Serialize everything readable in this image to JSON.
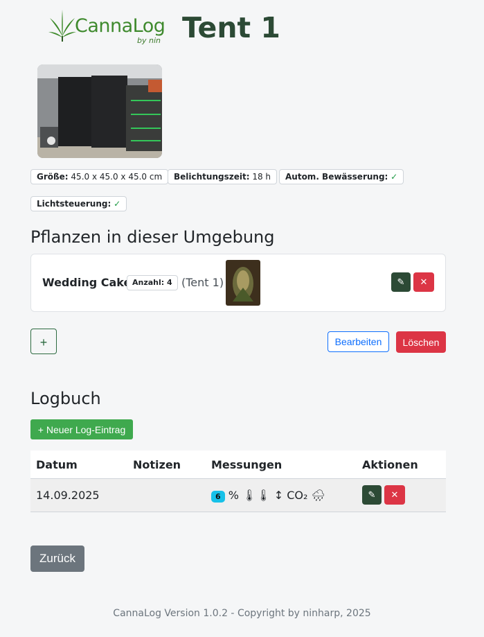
{
  "logo": {
    "text": "CannaLog",
    "sub": "by nin"
  },
  "page_title": "Tent 1",
  "badges": [
    {
      "label": "Größe:",
      "value": "45.0 x 45.0 x 45.0 cm"
    },
    {
      "label": "Belichtungszeit:",
      "value": "18 h"
    },
    {
      "label": "Autom. Bewässerung:",
      "value": "✓"
    },
    {
      "label": "Lichtsteuerung:",
      "value": "✓"
    }
  ],
  "plants_heading": "Pflanzen in dieser Umgebung",
  "plant": {
    "name": "Wedding Cake",
    "count_label": "Anzahl: 4",
    "location": "(Tent 1)",
    "edit_icon": "✎",
    "delete_icon": "✕"
  },
  "actions": {
    "add": "+",
    "edit": "Bearbeiten",
    "delete": "Löschen"
  },
  "logbook": {
    "heading": "Logbuch",
    "new_entry": "+ Neuer Log-Eintrag",
    "columns": [
      "Datum",
      "Notizen",
      "Messungen",
      "Aktionen"
    ],
    "rows": [
      {
        "date": "14.09.2025",
        "notes": "",
        "meas_badge": "6",
        "meas_text": " % 🌡🌡 ↕ CO₂ 🌧",
        "edit_icon": "✎",
        "delete_icon": "✕"
      }
    ]
  },
  "back_button": "Zurück",
  "footer": "CannaLog Version 1.0.2 - Copyright by ninharp, 2025",
  "colors": {
    "brand_green": "#2c4a35",
    "accent_green": "#3fa94e",
    "danger": "#dc3545",
    "primary": "#0d6efd",
    "info": "#17c1e8"
  }
}
